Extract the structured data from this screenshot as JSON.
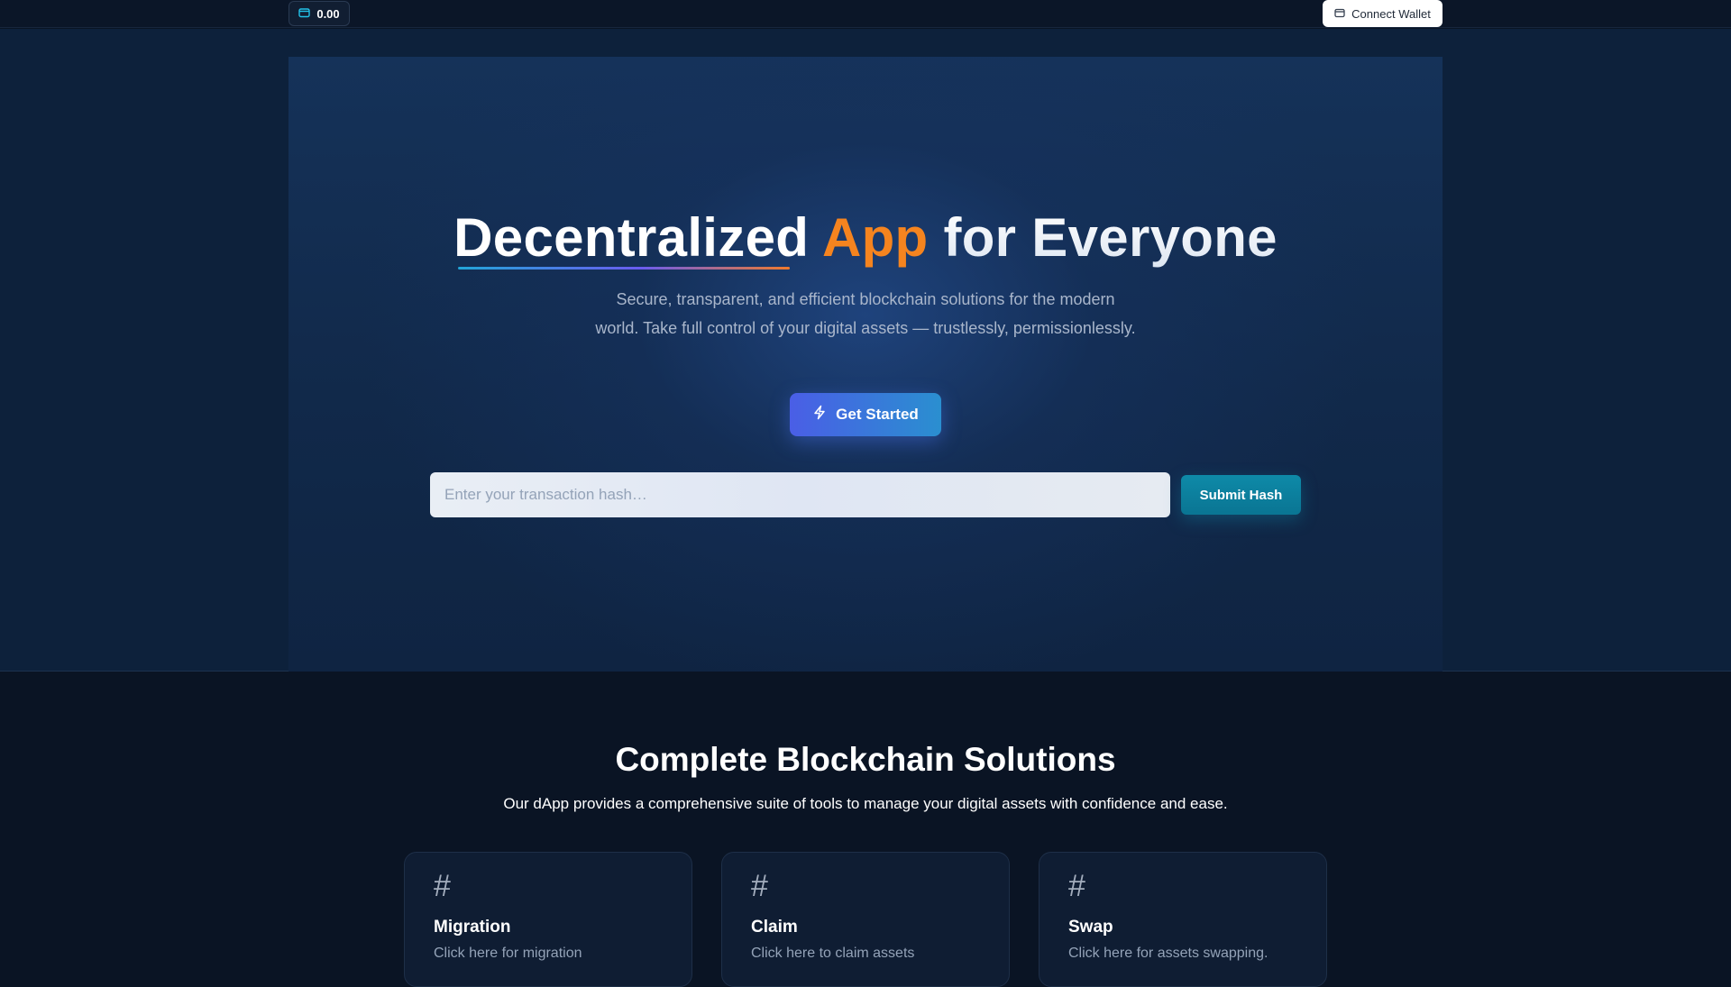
{
  "topbar": {
    "balance": "0.00",
    "balance_icon": "wallet-icon",
    "connect_label": "Connect Wallet",
    "connect_icon": "wallet-icon"
  },
  "hero": {
    "title_part1": "Decentralized",
    "title_part2": "App",
    "title_part3": "for Everyone",
    "subtitle": "Secure, transparent, and efficient blockchain solutions for the modern world. Take full control of your digital assets — trustlessly, permissionlessly.",
    "cta_label": "Get Started",
    "cta_icon": "lightning-icon",
    "hash_placeholder": "Enter your transaction hash…",
    "hash_value": "",
    "submit_label": "Submit Hash"
  },
  "features": {
    "title": "Complete Blockchain Solutions",
    "subtitle": "Our dApp provides a comprehensive suite of tools to manage your digital assets with confidence and ease.",
    "cards": [
      {
        "icon": "#",
        "title": "Migration",
        "desc": "Click here for migration"
      },
      {
        "icon": "#",
        "title": "Claim",
        "desc": "Click here to claim assets"
      },
      {
        "icon": "#",
        "title": "Swap",
        "desc": "Click here for assets swapping."
      }
    ]
  },
  "colors": {
    "accent_orange": "#f5841f",
    "cta_start": "#4a5ee6",
    "cta_end": "#2a8fd0",
    "submit": "#0e8aa8",
    "background": "#0a1424"
  }
}
